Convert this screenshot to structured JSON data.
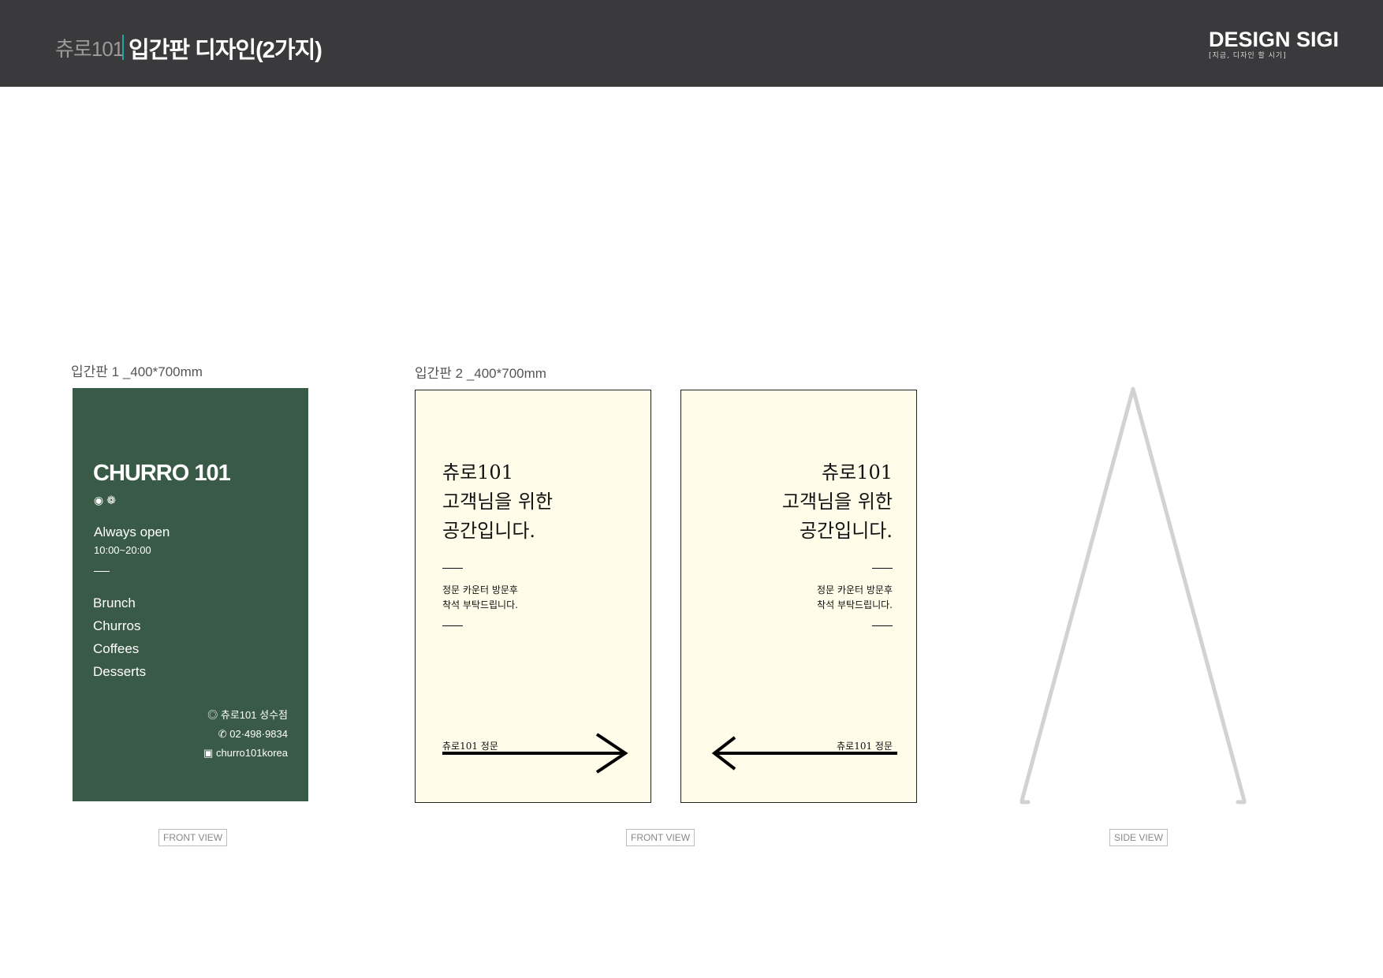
{
  "header": {
    "subtitle": "츄로101",
    "title": "입간판 디자인(2가지)",
    "logo": "DESIGN SIGI",
    "logo_tagline": "[지금, 디자인 할 시기]"
  },
  "board1": {
    "label": "입간판 1 _400*700mm",
    "brand": "CHURRO 101",
    "icons": [
      "sun-icon",
      "flower-icon"
    ],
    "open_text": "Always open",
    "hours": "10:00~20:00",
    "menu": [
      "Brunch",
      "Churros",
      "Coffees",
      "Desserts"
    ],
    "location": "츄로101 성수점",
    "phone": "02·498·9834",
    "instagram": "churro101korea",
    "background_color": "#3a5a48",
    "view_tag": "FRONT VIEW"
  },
  "board2": {
    "label": "입간판 2 _400*700mm",
    "headline": [
      "츄로101",
      "고객님을 위한",
      "공간입니다."
    ],
    "body": [
      "정문 카운터 방문후",
      "착석 부탁드립니다."
    ],
    "footer": "츄로101 정문",
    "background_color": "#fffce9",
    "view_tag": "FRONT VIEW"
  },
  "side": {
    "view_tag": "SIDE VIEW"
  }
}
